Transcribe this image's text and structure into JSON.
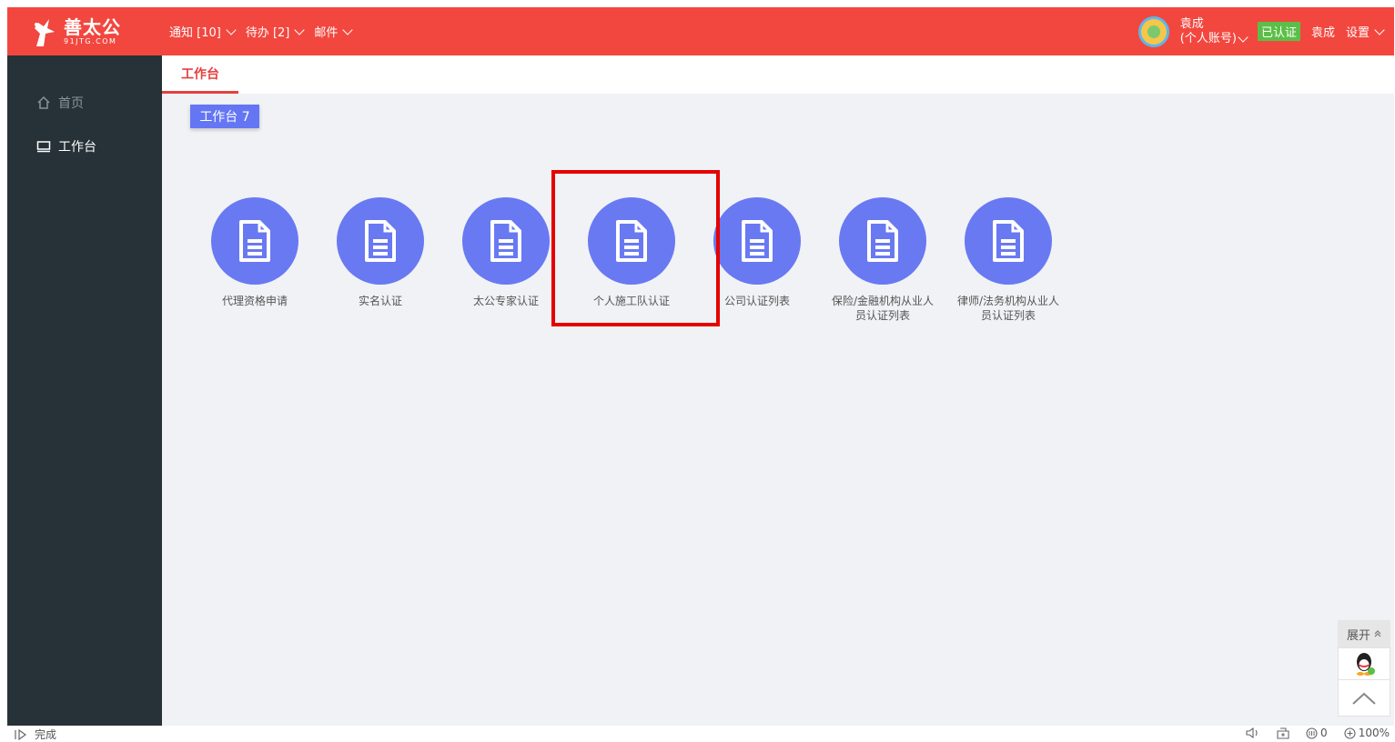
{
  "logo": {
    "main": "善太公",
    "sub": "91JTG.COM"
  },
  "topnav": [
    {
      "label": "通知 [10]"
    },
    {
      "label": "待办 [2]"
    },
    {
      "label": "邮件"
    }
  ],
  "user": {
    "name": "袁成",
    "account": "(个人账号)",
    "verified": "已认证",
    "display_name": "袁成",
    "settings": "设置"
  },
  "sidebar": [
    {
      "label": "首页",
      "icon": "home-icon"
    },
    {
      "label": "工作台",
      "icon": "monitor-icon"
    }
  ],
  "tab": {
    "label": "工作台"
  },
  "workspace_label": "工作台 7",
  "tiles": [
    {
      "label": "代理资格申请"
    },
    {
      "label": "实名认证"
    },
    {
      "label": "太公专家认证"
    },
    {
      "label": "个人施工队认证"
    },
    {
      "label": "公司认证列表"
    },
    {
      "label": "保险/金融机构从业人员认证列表"
    },
    {
      "label": "律师/法务机构从业人员认证列表"
    }
  ],
  "float": {
    "expand": "展开"
  },
  "statusbar": {
    "left": "完成",
    "counter": "0",
    "zoom": "100%"
  },
  "colors": {
    "topbar": "#f2473f",
    "sidebar": "#263238",
    "tile": "#6979f2",
    "accent": "#e53f3f",
    "highlight": "#e60000"
  }
}
